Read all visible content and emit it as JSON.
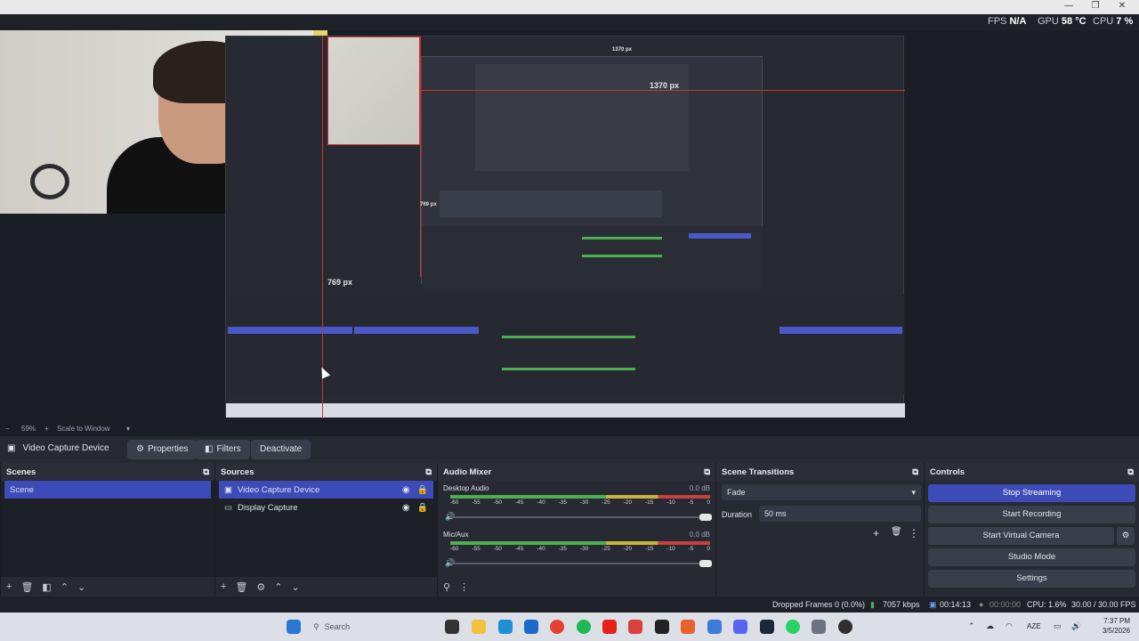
{
  "stats": {
    "fps_label": "FPS",
    "fps_value": "N/A",
    "gpu_label": "GPU",
    "gpu_value": "58 °C",
    "cpu_label": "CPU",
    "cpu_value": "7 %"
  },
  "preview": {
    "measure_width": "1370 px",
    "measure_height": "769 px",
    "measure_width_small": "1370 px",
    "measure_height_small": "769 px"
  },
  "zoom": {
    "minus": "−",
    "level": "59%",
    "plus": "+",
    "mode": "Scale to Window"
  },
  "context": {
    "source_name": "Video Capture Device",
    "properties_label": "Properties",
    "filters_label": "Filters",
    "deactivate_label": "Deactivate"
  },
  "scenes": {
    "title": "Scenes",
    "items": [
      "Scene"
    ]
  },
  "sources": {
    "title": "Sources",
    "items": [
      "Video Capture Device",
      "Display Capture"
    ]
  },
  "mixer": {
    "title": "Audio Mixer",
    "channels": [
      {
        "name": "Desktop Audio",
        "db": "0.0 dB"
      },
      {
        "name": "Mic/Aux",
        "db": "0.0 dB"
      }
    ],
    "ticks": [
      "-60",
      "-55",
      "-50",
      "-45",
      "-40",
      "-35",
      "-30",
      "-25",
      "-20",
      "-15",
      "-10",
      "-5",
      "0"
    ]
  },
  "transitions": {
    "title": "Scene Transitions",
    "selected": "Fade",
    "duration_label": "Duration",
    "duration_value": "50 ms"
  },
  "controls": {
    "title": "Controls",
    "stop_streaming": "Stop Streaming",
    "start_recording": "Start Recording",
    "start_virtual_camera": "Start Virtual Camera",
    "studio_mode": "Studio Mode",
    "settings": "Settings"
  },
  "status": {
    "dropped_frames": "Dropped Frames 0 (0.0%)",
    "bitrate": "7057 kbps",
    "stream_time": "00:14:13",
    "record_time": "00:00:00",
    "cpu": "CPU: 1.6%",
    "fps": "30.00 / 30.00 FPS"
  },
  "taskbar": {
    "search_placeholder": "Search",
    "lang": "AZE",
    "time": "7:37 PM",
    "date": "3/5/2026"
  },
  "colors": {
    "accent": "#3c4bb7",
    "panel": "#272a33",
    "list_bg": "#1e2028",
    "measure_line": "#d0312d"
  }
}
